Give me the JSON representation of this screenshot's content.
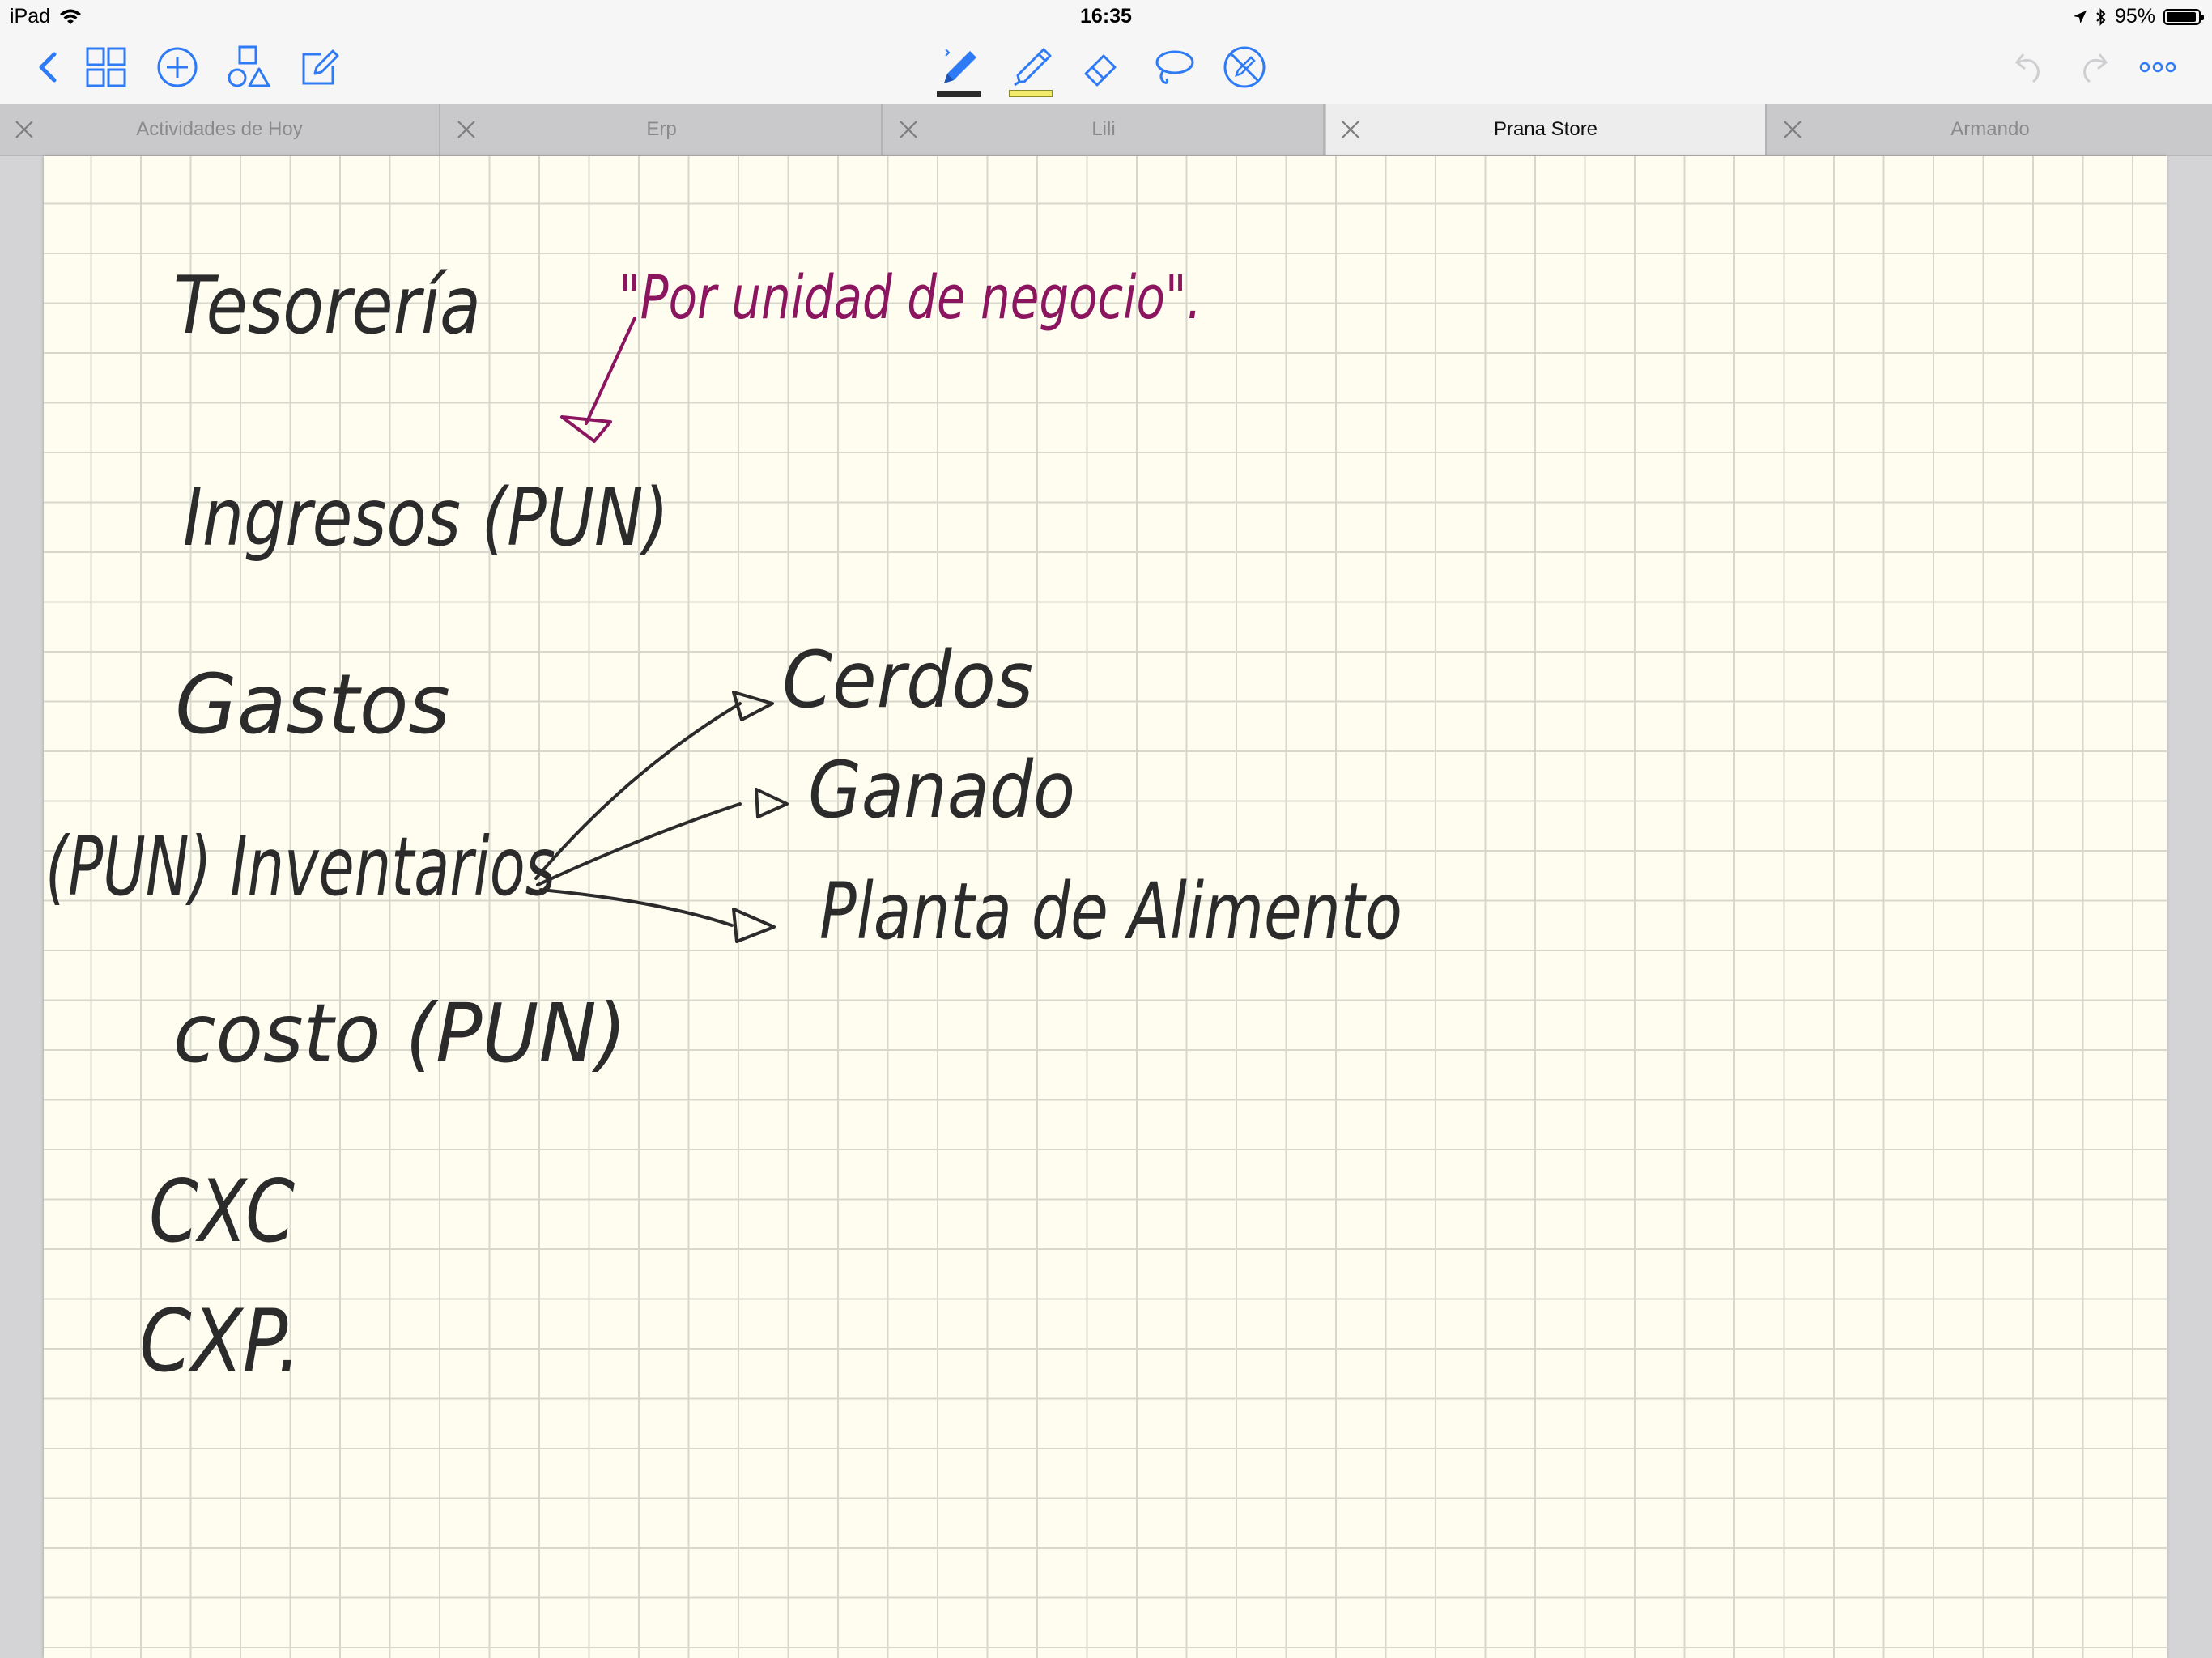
{
  "status_bar": {
    "device": "iPad",
    "time": "16:35",
    "battery": "95%",
    "battery_level": 0.95
  },
  "toolbar": {
    "left_icons": [
      "back-chevron-icon",
      "grid-icon",
      "add-circle-icon",
      "shapes-icon",
      "edit-icon"
    ],
    "center_tools": [
      "pen-icon",
      "highlighter-icon",
      "eraser-icon",
      "lasso-icon",
      "no-input-icon"
    ],
    "right_icons": [
      "undo-icon",
      "redo-icon",
      "more-icon"
    ],
    "pen_color": "#2b2b2b",
    "highlighter_color": "#f2ea6b",
    "accent": "#2f7bf6"
  },
  "tabs": [
    {
      "label": "Actividades de Hoy",
      "active": false
    },
    {
      "label": "Erp",
      "active": false
    },
    {
      "label": "Lili",
      "active": false
    },
    {
      "label": "Prana Store",
      "active": true
    },
    {
      "label": "Armando",
      "active": false
    }
  ],
  "note": {
    "paper_color": "#fffdf0",
    "ink_color": "#2b2b2b",
    "annotation_color": "#8c1560",
    "handwriting": {
      "tesoreria": "Tesorería",
      "annotation": "\"Por unidad de negocio\".",
      "ingresos": "Ingresos (PUN)",
      "gastos": "Gastos",
      "inventarios": "(PUN) Inventarios",
      "cerdos": "Cerdos",
      "ganado": "Ganado",
      "planta": "Planta de Alimento",
      "costo": "costo (PUN)",
      "cxc": "CXC",
      "cxp": "CXP."
    }
  }
}
